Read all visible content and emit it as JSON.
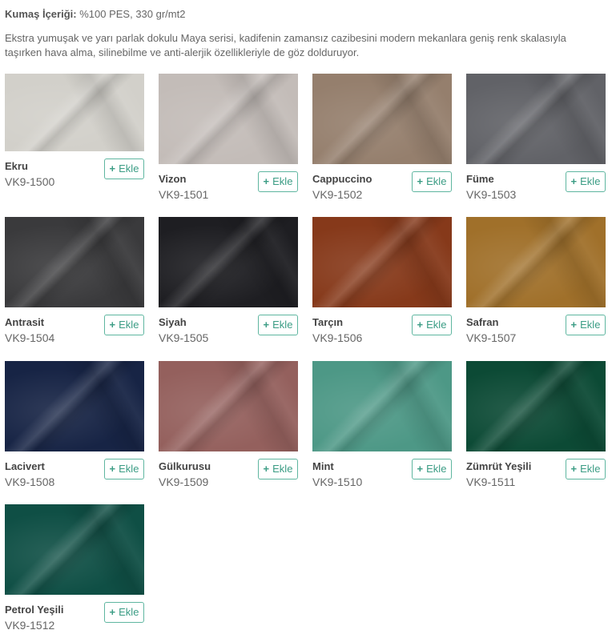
{
  "content": {
    "label": "Kumaş İçeriği:",
    "value": "%100 PES, 330 gr/mt2"
  },
  "description": "Ekstra yumuşak ve yarı parlak dokulu Maya serisi, kadifenin zamansız cazibesini modern mekanlara geniş renk skalasıyla taşırken hava alma, silinebilme ve anti-alerjik özellikleriyle de göz dolduruyor.",
  "add_label": "Ekle",
  "plus_icon": "plus-icon",
  "products": [
    {
      "name": "Ekru",
      "code": "VK9-1500",
      "color": "#d2d0ca"
    },
    {
      "name": "Vizon",
      "code": "VK9-1501",
      "color": "#c3bcb8"
    },
    {
      "name": "Cappuccino",
      "code": "VK9-1502",
      "color": "#957f6d"
    },
    {
      "name": "Füme",
      "code": "VK9-1503",
      "color": "#616267"
    },
    {
      "name": "Antrasit",
      "code": "VK9-1504",
      "color": "#3a3a3c"
    },
    {
      "name": "Siyah",
      "code": "VK9-1505",
      "color": "#1e1e22"
    },
    {
      "name": "Tarçın",
      "code": "VK9-1506",
      "color": "#86391a"
    },
    {
      "name": "Safran",
      "code": "VK9-1507",
      "color": "#a0702a"
    },
    {
      "name": "Lacivert",
      "code": "VK9-1508",
      "color": "#172445"
    },
    {
      "name": "Gülkurusu",
      "code": "VK9-1509",
      "color": "#94605d"
    },
    {
      "name": "Mint",
      "code": "VK9-1510",
      "color": "#4d9886"
    },
    {
      "name": "Zümrüt Yeşili",
      "code": "VK9-1511",
      "color": "#0c4a35"
    },
    {
      "name": "Petrol Yeşili",
      "code": "VK9-1512",
      "color": "#0f4f45"
    }
  ]
}
